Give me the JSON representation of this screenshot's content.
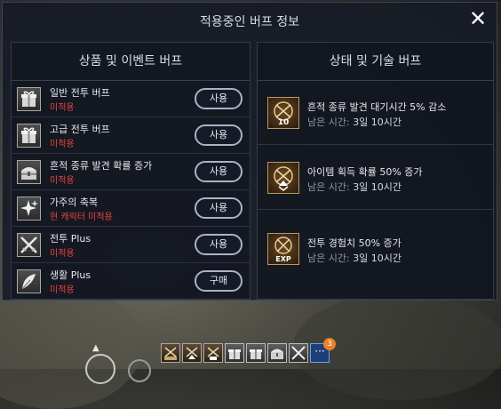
{
  "dialog": {
    "title": "적용중인 버프 정보",
    "close_label": "✕"
  },
  "left_panel": {
    "title": "상품 및 이벤트 버프",
    "items": [
      {
        "name": "일반 전투 버프",
        "status": "미적용",
        "button": "사용",
        "icon": "gift-box-icon"
      },
      {
        "name": "고급 전투 버프",
        "status": "미적용",
        "button": "사용",
        "icon": "gift-box-icon"
      },
      {
        "name": "흔적 종류 발견 확률 증가",
        "status": "미적용",
        "button": "사용",
        "icon": "treasure-chest-icon"
      },
      {
        "name": "가주의 축복",
        "status": "현 캐릭터 미적용",
        "button": "사용",
        "icon": "sparkle-icon"
      },
      {
        "name": "전투 Plus",
        "status": "미적용",
        "button": "사용",
        "icon": "crossed-swords-icon"
      },
      {
        "name": "생활 Plus",
        "status": "미적용",
        "button": "구매",
        "icon": "feather-icon"
      }
    ]
  },
  "right_panel": {
    "title": "상태 및 기술 버프",
    "items": [
      {
        "name": "흔적 종류 발견 대기시간 5% 감소",
        "time_label": "남은 시간:",
        "time_value": "3일 10시간",
        "icon": "trace-10-icon",
        "icon_text": "10"
      },
      {
        "name": "아이템 획득 확률 50% 증가",
        "time_label": "남은 시간:",
        "time_value": "3일 10시간",
        "icon": "item-up-icon",
        "icon_text": ""
      },
      {
        "name": "전투 경험치 50% 증가",
        "time_label": "남은 시간:",
        "time_value": "3일 10시간",
        "icon": "exp-icon",
        "icon_text": "EXP"
      }
    ]
  },
  "hotbar": {
    "slots": [
      "exp-buff-icon",
      "item-buff-icon",
      "trace-buff-icon",
      "gift-box-icon",
      "gift-box-icon",
      "treasure-chest-icon",
      "crossed-swords-icon",
      "more-icon"
    ],
    "more_label": "···",
    "badge": "3"
  },
  "colors": {
    "status_red": "#e8453c",
    "panel_bg": "#161b26",
    "accent_border": "#a9b3c6"
  }
}
